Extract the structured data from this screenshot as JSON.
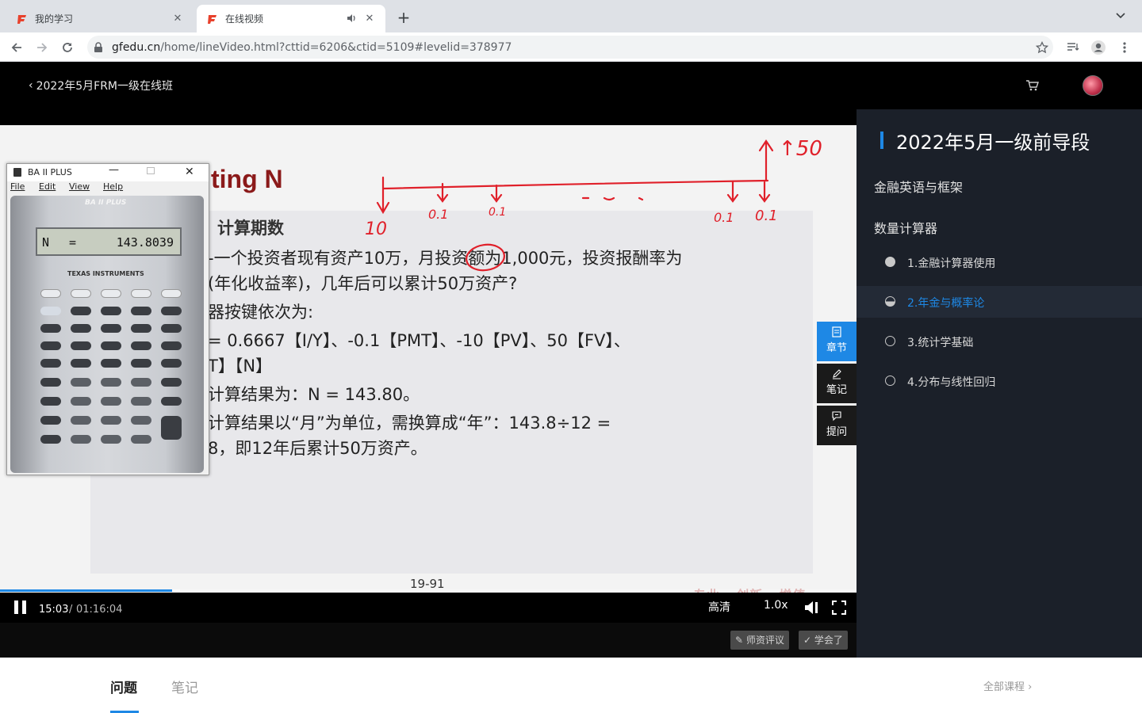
{
  "browser": {
    "tabs": [
      {
        "title": "我的学习",
        "active": false
      },
      {
        "title": "在线视频",
        "active": true
      }
    ],
    "url_host": "gfedu.cn",
    "url_path": "/home/lineVideo.html?cttid=6206&ctid=5109#levelid=378977"
  },
  "site": {
    "back_label": "2022年5月FRM一级在线班"
  },
  "slide": {
    "title": "ting N",
    "subtitle": "计算期数",
    "lines": [
      "-一个投资者现有资产10万，月投资额为1,000元，投资报酬率为",
      "(年化收益率)，几年后可以累计50万资产?",
      "器按键依次为:",
      "= 0.6667【I/Y】、-0.1【PMT】、-10【PV】、50【FV】、",
      "T】【N】",
      "计算结果为：N = 143.80。",
      "计算结果以“月”为单位，需换算成“年”：143.8÷12 =",
      "8，即12年后累计50万资产。"
    ],
    "page": "19-91",
    "watermark": "专业 · 创新 · 增值",
    "annotations": [
      "↑50",
      "10",
      "0.1",
      "0.1",
      "0.1",
      "0.1"
    ]
  },
  "calculator": {
    "window_title": "BA II PLUS",
    "menus": [
      "File",
      "Edit",
      "View",
      "Help"
    ],
    "brand": "BA II PLUS",
    "display_label": "N",
    "display_eq": "=",
    "display_value": "143.8039",
    "maker": "TEXAS INSTRUMENTS"
  },
  "video_side": {
    "chapter": "章节",
    "notes": "笔记",
    "ask": "提问"
  },
  "player": {
    "current_time": "15:03",
    "separator": "/",
    "total_time": "01:16:04",
    "progress": 0.201,
    "buffered": 0.21,
    "quality": "高清",
    "speed": "1.0x",
    "rate_button": "师资评议",
    "learned_button": "学会了"
  },
  "sidebar": {
    "title": "2022年5月一级前导段",
    "sections": [
      {
        "title": "金融英语与框架"
      },
      {
        "title": "数量计算器"
      }
    ],
    "lessons": [
      {
        "label": "1.金融计算器使用",
        "status": "done"
      },
      {
        "label": "2.年金与概率论",
        "status": "in-progress"
      },
      {
        "label": "3.统计学基础",
        "status": "not-started"
      },
      {
        "label": "4.分布与线性回归",
        "status": "not-started"
      }
    ]
  },
  "bottom": {
    "tab_questions": "问题",
    "tab_notes": "笔记",
    "all_courses": "全部课程 ›"
  },
  "colors": {
    "accent": "#1e88e5",
    "header_bg": "#000000",
    "sidebar_bg": "#1b2029",
    "annotation_red": "#e0202a"
  }
}
